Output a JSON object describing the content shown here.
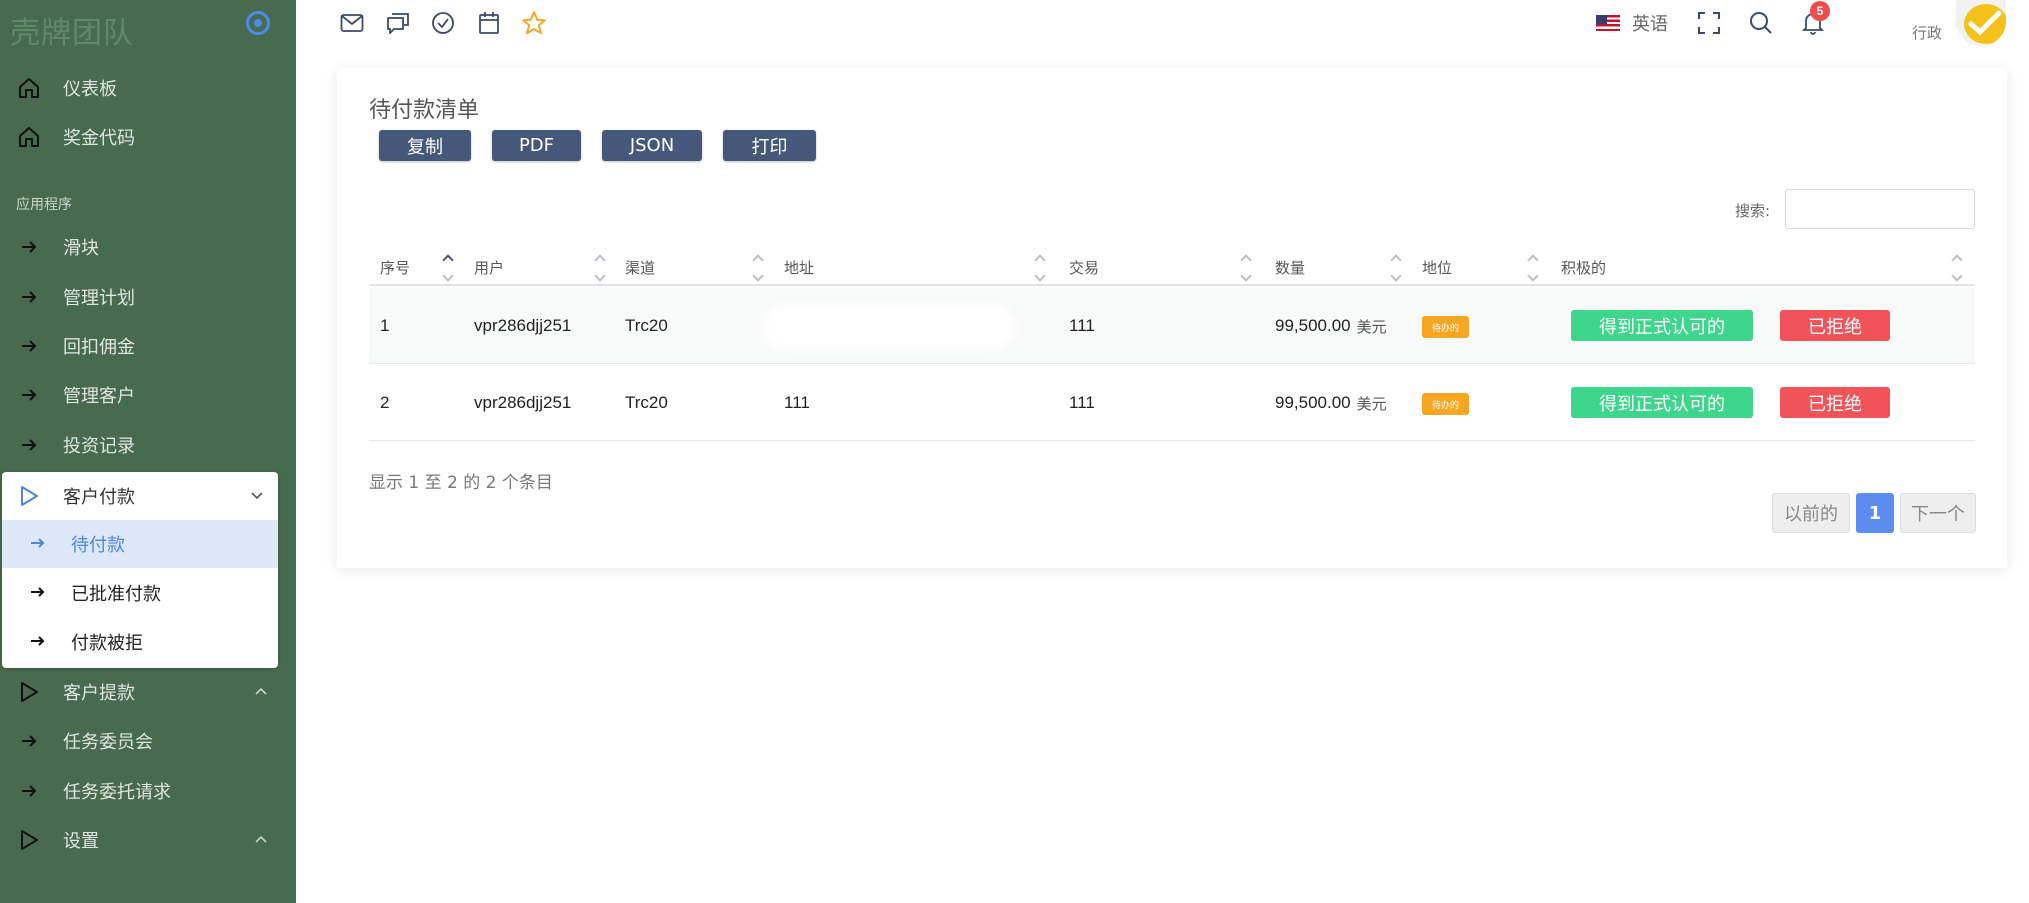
{
  "sidebar": {
    "brand": "壳牌团队",
    "items_top": [
      {
        "label": "仪表板",
        "icon": "home-icon"
      },
      {
        "label": "奖金代码",
        "icon": "home-icon"
      }
    ],
    "section_title": "应用程序",
    "items_app": [
      {
        "label": "滑块"
      },
      {
        "label": "管理计划"
      },
      {
        "label": "回扣佣金"
      },
      {
        "label": "管理客户"
      },
      {
        "label": "投资记录"
      }
    ],
    "group_payments": {
      "label": "客户付款",
      "items": [
        {
          "label": "待付款"
        },
        {
          "label": "已批准付款"
        },
        {
          "label": "付款被拒"
        }
      ]
    },
    "items_bottom": [
      {
        "label": "客户提款",
        "type": "group"
      },
      {
        "label": "任务委员会",
        "type": "link"
      },
      {
        "label": "任务委托请求",
        "type": "link"
      },
      {
        "label": "设置",
        "type": "group"
      }
    ]
  },
  "topbar": {
    "language": "英语",
    "notification_count": "5",
    "user_role": "行政"
  },
  "card": {
    "title": "待付款清单",
    "buttons": [
      "复制",
      "PDF",
      "JSON",
      "打印"
    ],
    "search_label": "搜索:",
    "search_value": "",
    "columns": [
      "序号",
      "用户",
      "渠道",
      "地址",
      "交易",
      "数量",
      "地位",
      "积极的"
    ],
    "rows": [
      {
        "no": "1",
        "user": "vpr286djj251",
        "channel": "Trc20",
        "address": "",
        "txn": "111",
        "amount": "99,500.00",
        "unit": "美元",
        "status": "待办的",
        "approve": "得到正式认可的",
        "reject": "已拒绝"
      },
      {
        "no": "2",
        "user": "vpr286djj251",
        "channel": "Trc20",
        "address": "111",
        "txn": "111",
        "amount": "99,500.00",
        "unit": "美元",
        "status": "待办的",
        "approve": "得到正式认可的",
        "reject": "已拒绝"
      }
    ],
    "info": "显示 1 至 2 的 2 个条目",
    "pagination": {
      "prev": "以前的",
      "current": "1",
      "next": "下一个"
    }
  }
}
